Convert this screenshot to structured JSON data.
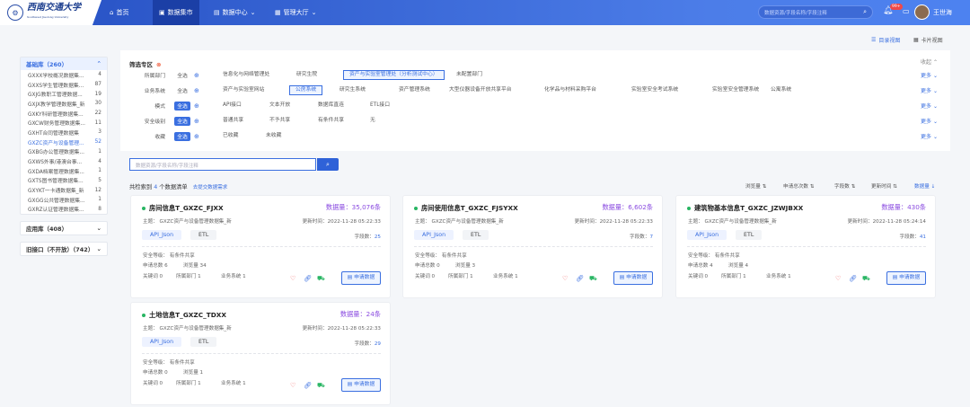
{
  "header": {
    "logo_text": "西南交通大学",
    "logo_sub": "Southwest Jiaotong University",
    "nav": [
      {
        "label": "首页",
        "icon": "home-icon"
      },
      {
        "label": "数据集市",
        "icon": "grid-icon"
      },
      {
        "label": "数据中心",
        "icon": "database-icon"
      },
      {
        "label": "管理大厅",
        "icon": "apps-icon"
      }
    ],
    "search_placeholder": "数据资源/字段名称/字段注释",
    "badge": "99+",
    "user_name": "王世海"
  },
  "view_switch": {
    "catalog": "目录视图",
    "card": "卡片视图"
  },
  "sidebar": {
    "groups": [
      {
        "label": "基础库（260）",
        "expanded": true,
        "items": [
          {
            "name": "GXXX学校概况数据集...",
            "count": "4"
          },
          {
            "name": "GXXS学生管理数据集...",
            "count": "87"
          },
          {
            "name": "GXJG教职工管理数据...",
            "count": "19"
          },
          {
            "name": "GXJX教学管理数据集_新",
            "count": "30"
          },
          {
            "name": "GXKY科研管理数据集...",
            "count": "22"
          },
          {
            "name": "GXCW财务管理数据集...",
            "count": "11"
          },
          {
            "name": "GXHT合同管理数据集",
            "count": "3"
          },
          {
            "name": "GXZC资产与设备管理...",
            "count": "52"
          },
          {
            "name": "GXBG办公管理数据集...",
            "count": "1"
          },
          {
            "name": "GXWS外事/港澳台事...",
            "count": "4"
          },
          {
            "name": "GXDA档案管理数据集...",
            "count": "1"
          },
          {
            "name": "GXTS图书管理数据集...",
            "count": "5"
          },
          {
            "name": "GXYKT一卡通数据集_新",
            "count": "12"
          },
          {
            "name": "GXGG公共管理数据集...",
            "count": "1"
          },
          {
            "name": "GXRZ认证管理数据集...",
            "count": "8"
          }
        ]
      },
      {
        "label": "应用库（408）"
      },
      {
        "label": "旧接口（不开放）（742）"
      }
    ]
  },
  "filter": {
    "title": "筛选专区",
    "collapse": "收起",
    "more": "更多",
    "all": "全选",
    "rows": [
      {
        "label": "所属部门",
        "options": [
          "信息化与网络管理处",
          "研究生院",
          "资产与实验室管理处（分析测试中心）",
          "未配置部门"
        ]
      },
      {
        "label": "业务系统",
        "options": [
          "资产与实验室网站",
          "公房系统",
          "研究生系统",
          "资产管理系统",
          "大型仪器设备开放共享平台",
          "化学品与材料采购平台",
          "实验室安全考试系统",
          "实验室安全管理系统",
          "公寓系统"
        ]
      },
      {
        "label": "模式",
        "options": [
          "API接口",
          "文本开放",
          "数据库直连",
          "ETL接口"
        ]
      },
      {
        "label": "安全级别",
        "options": [
          "普通共享",
          "不予共享",
          "有条件共享",
          "无"
        ]
      },
      {
        "label": "收藏",
        "options": [
          "已收藏",
          "未收藏"
        ]
      }
    ]
  },
  "search": {
    "placeholder": "数据资源/字段名称/字段注释"
  },
  "results": {
    "prefix": "共检索到",
    "count": "4",
    "suffix": "个数据清单",
    "request_link": "去提交数据需求",
    "sorts": [
      "浏览量",
      "申请总次数",
      "字段数",
      "更新时间",
      "数据量"
    ]
  },
  "cards": [
    {
      "title": "房间信息T_GXZC_FJXX",
      "volume": "数据量：35,076条",
      "subject": "主题：   GXZC资产与设备管理数据集_新",
      "updated": "更新时间：2022-11-28 05:22:33",
      "tags": [
        "API_Json",
        "ETL"
      ],
      "fields_label": "字段数：",
      "fields": "25",
      "security": "安全等级：   有条件共享",
      "apply": "申请总数  6",
      "browse": "浏览量  34",
      "related_label": "关键词  0",
      "dept": "所属部门  1",
      "sys": "业务系统  1",
      "apply_btn": "申请数据"
    },
    {
      "title": "房间使用信息T_GXZC_FJSYXX",
      "volume": "数据量：6,602条",
      "subject": "主题：   GXZC资产与设备管理数据集_新",
      "updated": "更新时间：2022-11-28 05:22:33",
      "tags": [
        "API_Json",
        "ETL"
      ],
      "fields_label": "字段数：",
      "fields": "7",
      "security": "安全等级：   有条件共享",
      "apply": "申请总数  0",
      "browse": "浏览量  3",
      "related_label": "关键词  0",
      "dept": "所属部门  1",
      "sys": "业务系统  1",
      "apply_btn": "申请数据"
    },
    {
      "title": "建筑物基本信息T_GXZC_JZWJBXX",
      "volume": "数据量：430条",
      "subject": "主题：   GXZC资产与设备管理数据集_新",
      "updated": "更新时间：2022-11-28 05:24:14",
      "tags": [
        "API_Json",
        "ETL"
      ],
      "fields_label": "字段数：",
      "fields": "41",
      "security": "安全等级：   有条件共享",
      "apply": "申请总数  4",
      "browse": "浏览量  4",
      "related_label": "关键词  0",
      "dept": "所属部门  1",
      "sys": "业务系统  1",
      "apply_btn": "申请数据"
    },
    {
      "title": "土地信息T_GXZC_TDXX",
      "volume": "数据量：24条",
      "subject": "主题：   GXZC资产与设备管理数据集_新",
      "updated": "更新时间：2022-11-28 05:22:33",
      "tags": [
        "API_Json",
        "ETL"
      ],
      "fields_label": "字段数：",
      "fields": "29",
      "security": "安全等级：   有条件共享",
      "apply": "申请总数  0",
      "browse": "浏览量  1",
      "related_label": "关键词  0",
      "dept": "所属部门  1",
      "sys": "业务系统  1",
      "apply_btn": "申请数据"
    }
  ]
}
